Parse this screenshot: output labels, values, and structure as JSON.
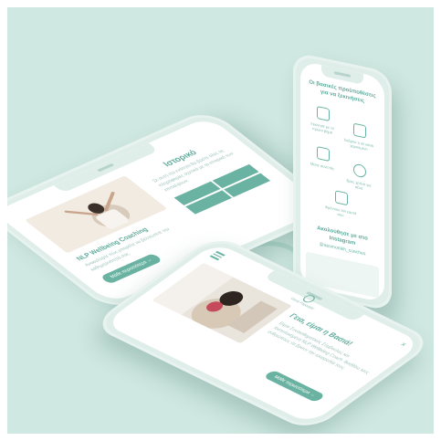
{
  "colors": {
    "background": "#cfe8e1",
    "accent": "#6ab3a2",
    "phone_body": "#dfeee9"
  },
  "left_phone": {
    "heading": "Ιστορικό",
    "intro_text": "Σε αυτή την ενότητα θα βρείτε όλες τις πληροφορίες σχετικά με το ιστορικό των επισκέψεων.",
    "card_title": "NLP Wellbeing Coaching",
    "card_text": "Ανακαλύψτε πώς μπορείτε να βελτιώσετε την καθημερινότητά σας.",
    "button_label": "Μάθε περισσότερα",
    "icon": "arrow-right-icon"
  },
  "right_phone": {
    "heading": "Οι βασικές προϋποθέσεις για να ξεκινήσεις",
    "features": [
      {
        "label": "Ξεκίνησε με το πρώτο βήμα",
        "icon": "handshake-icon"
      },
      {
        "label": "Σκέψου τι σε κάνει χαρούμενο",
        "icon": "box-icon"
      },
      {
        "label": "Μείνε συνεπής",
        "icon": "cube-icon"
      },
      {
        "label": "Βρες χρόνο για σένα",
        "icon": "person-icon"
      },
      {
        "label": "Φρόντισε τον εαυτό σου",
        "icon": "heart-hand-icon"
      }
    ],
    "social_title": "Ακολούθησε με στο Instagram",
    "social_handle": "@aesmonikh_coaches"
  },
  "bottom_phone": {
    "logo": "Vasia Papadaki",
    "heading": "Γεια, είμαι η Βασιά!",
    "body_text": "Είμαι Συναισθηματικός Σύμβουλος και πιστοποιημένη NLP Wellbeing Coach. Βοηθάω τους ανθρώπους να βρουν την ισορροπία τους.",
    "button_label": "Μάθε περισσότερα",
    "menu_icon": "menu-icon",
    "close_icon": "close-icon"
  }
}
